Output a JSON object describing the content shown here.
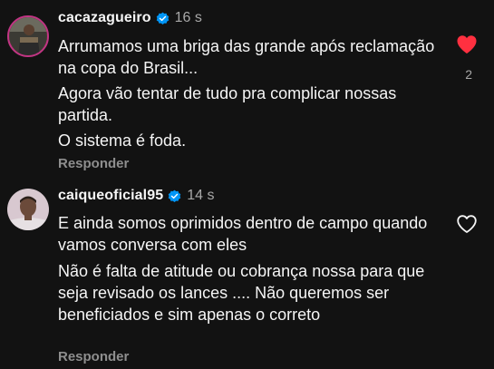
{
  "comments": [
    {
      "username": "cacazagueiro",
      "verified": true,
      "time": "16 s",
      "paragraphs": [
        "Arrumamos uma briga das grande após reclamação na copa do Brasil...",
        "Agora vão tentar de tudo pra complicar nossas partida.",
        "O sistema é foda."
      ],
      "reply_label": "Responder",
      "liked": true,
      "like_count": "2"
    },
    {
      "username": "caiqueoficial95",
      "verified": true,
      "time": "14 s",
      "paragraphs": [
        "E ainda somos oprimidos dentro de campo quando vamos conversa com eles",
        "Não é falta de atitude ou cobrança nossa para que seja revisado os lances .... Não queremos ser beneficiados e sim apenas o correto"
      ],
      "reply_label": "Responder",
      "liked": false
    }
  ],
  "colors": {
    "background": "#121212",
    "text": "#f5f5f5",
    "muted": "#a8a8a8",
    "like_red": "#ff3040",
    "verified_blue": "#0095f6"
  },
  "icons": [
    "verified-badge-icon",
    "heart-filled-icon",
    "heart-outline-icon"
  ]
}
